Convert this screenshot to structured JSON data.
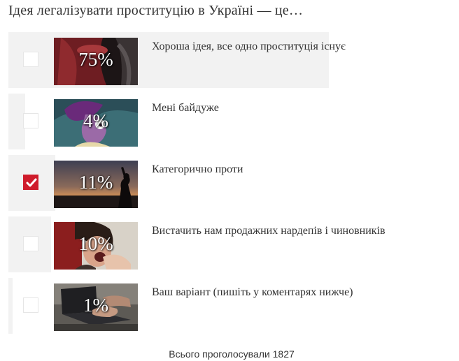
{
  "poll": {
    "question": "Ідея легалізувати проституцію в Україні — це…",
    "options": [
      {
        "label": "Хороша ідея, все одно проституція існує",
        "percent": 75,
        "percent_label": "75%",
        "checked": false,
        "image_icon": "stockings-photo"
      },
      {
        "label": "Мені байдуже",
        "percent": 4,
        "percent_label": "4%",
        "checked": false,
        "image_icon": "cartoon-woman-image"
      },
      {
        "label": "Категорично проти",
        "percent": 11,
        "percent_label": "11%",
        "checked": true,
        "image_icon": "silhouette-sunset-photo"
      },
      {
        "label": "Вистачить нам продажних нардепів і чиновників",
        "percent": 10,
        "percent_label": "10%",
        "checked": false,
        "image_icon": "shouting-woman-photo"
      },
      {
        "label": "Ваш варіант (пишіть у коментарях нижче)",
        "percent": 1,
        "percent_label": "1%",
        "checked": false,
        "image_icon": "laptop-typing-photo"
      }
    ],
    "total_votes_text": "Всього проголосували 1827"
  },
  "colors": {
    "bar": "#f2f2f2",
    "checked": "#cf1b2b",
    "text": "#333333"
  }
}
